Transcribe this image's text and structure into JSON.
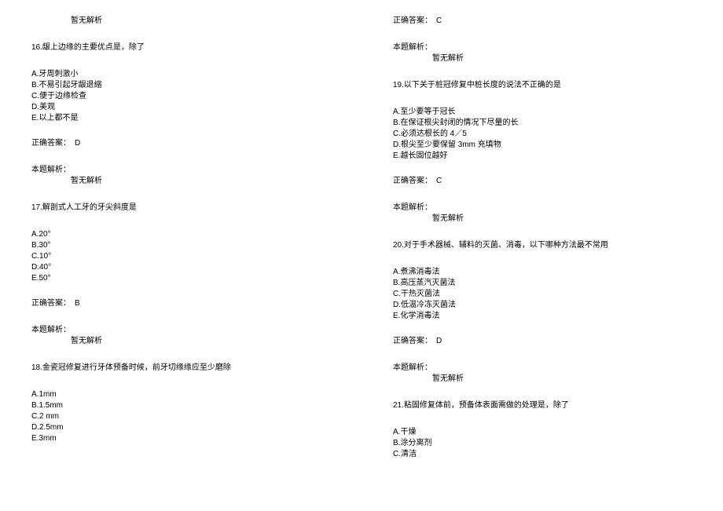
{
  "left": {
    "no_analysis": "暂无解析",
    "q16": {
      "stem": "16.龈上边缘的主要优点是，除了",
      "optA": "A.牙周刺激小",
      "optB": "B.不易引起牙龈退缩",
      "optC": "C.便于边缘检查",
      "optD": "D.美观",
      "optE": "E.以上都不是",
      "answer_label": "正确答案：　D",
      "analysis_label": "本题解析：",
      "analysis_text": "暂无解析"
    },
    "q17": {
      "stem": "17.解剖式人工牙的牙尖斜度是",
      "optA": "A.20°",
      "optB": "B.30°",
      "optC": "C.10°",
      "optD": "D.40°",
      "optE": "E.50°",
      "answer_label": "正确答案：　B",
      "analysis_label": "本题解析：",
      "analysis_text": "暂无解析"
    },
    "q18": {
      "stem": "18.金瓷冠修复进行牙体预备时候，前牙切缘缘应至少磨除",
      "optA": "A.1mm",
      "optB": "B.1.5mm",
      "optC": "C.2 mm",
      "optD": "D.2.5mm",
      "optE": "E.3mm"
    }
  },
  "right": {
    "answer_c": "正确答案：　C",
    "analysis_label_top": "本题解析：",
    "analysis_text_top": "暂无解析",
    "q19": {
      "stem": "19.以下关于桩冠修复中桩长度的说法不正确的是",
      "optA": "A.至少要等于冠长",
      "optB": "B.在保证根尖封闭的情况下尽量的长",
      "optC": "C.必须达根长的 4／5",
      "optD": "D.根尖至少要保留 3mm 充填物",
      "optE": "E.越长固位越好",
      "answer_label": "正确答案：　C",
      "analysis_label": "本题解析：",
      "analysis_text": "暂无解析"
    },
    "q20": {
      "stem": "20.对于手术器械、辅料的灭菌、消毒，以下哪种方法最不常用",
      "optA": "A.煮沸消毒法",
      "optB": "B.高压蒸汽灭菌法",
      "optC": "C.干热灭菌法",
      "optD": "D.低温冷冻灭菌法",
      "optE": "E.化学消毒法",
      "answer_label": "正确答案：　D",
      "analysis_label": "本题解析：",
      "analysis_text": "暂无解析"
    },
    "q21": {
      "stem": "21.粘固修复体前，预备体表面需做的处理是，除了",
      "optA": "A.干燥",
      "optB": "B.涂分离剂",
      "optC": "C.清洁"
    }
  }
}
